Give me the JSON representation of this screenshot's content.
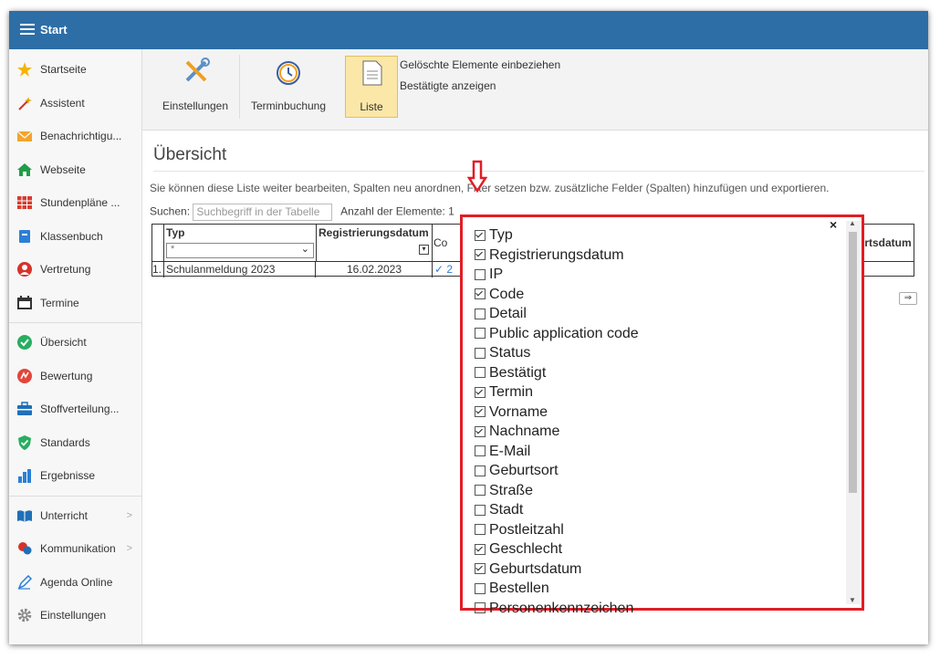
{
  "topbar": {
    "title": "Start"
  },
  "sidebar": {
    "items": [
      {
        "label": "Startseite",
        "icon": "star-icon"
      },
      {
        "label": "Assistent",
        "icon": "magic-wand-icon"
      },
      {
        "label": "Benachrichtigu...",
        "icon": "envelope-icon"
      },
      {
        "label": "Webseite",
        "icon": "home-icon"
      },
      {
        "label": "Stundenpläne ...",
        "icon": "timetable-icon"
      },
      {
        "label": "Klassenbuch",
        "icon": "book-icon"
      },
      {
        "label": "Vertretung",
        "icon": "substitute-icon"
      },
      {
        "label": "Termine",
        "icon": "calendar-icon"
      },
      {
        "label": "Übersicht",
        "icon": "check-circle-icon"
      },
      {
        "label": "Bewertung",
        "icon": "grade-icon"
      },
      {
        "label": "Stoffverteilung...",
        "icon": "briefcase-icon"
      },
      {
        "label": "Standards",
        "icon": "shield-check-icon"
      },
      {
        "label": "Ergebnisse",
        "icon": "bar-chart-icon"
      },
      {
        "label": "Unterricht",
        "icon": "open-book-icon"
      },
      {
        "label": "Kommunikation",
        "icon": "chat-icon"
      },
      {
        "label": "Agenda Online",
        "icon": "pen-icon"
      },
      {
        "label": "Einstellungen",
        "icon": "gear-icon"
      }
    ]
  },
  "ribbon": {
    "settings_label": "Einstellungen",
    "booking_label": "Terminbuchung",
    "list_label": "Liste",
    "opt_deleted": "Gelöschte Elemente einbeziehen",
    "opt_confirmed": "Bestätigte anzeigen"
  },
  "main": {
    "title": "Übersicht",
    "info": "Sie können diese Liste weiter bearbeiten, Spalten neu anordnen, Filter setzen bzw. zusätzliche Felder (Spalten) hinzufügen und exportieren.",
    "search_label": "Suchen:",
    "search_placeholder": "Suchbegriff in der Tabelle",
    "count_label": "Anzahl der Elemente: 1"
  },
  "table": {
    "col_typ": "Typ",
    "col_reg": "Registrierungsdatum",
    "col_code": "Co",
    "col_geb": "urtsdatum",
    "filter_typ": "*",
    "row": {
      "index": "1.",
      "typ": "Schulanmeldung 2023",
      "reg": "16.02.2023",
      "code": "✓ 2"
    }
  },
  "popup": {
    "close": "×",
    "items": [
      {
        "label": "Typ",
        "checked": true
      },
      {
        "label": "Registrierungsdatum",
        "checked": true
      },
      {
        "label": "IP",
        "checked": false
      },
      {
        "label": "Code",
        "checked": true
      },
      {
        "label": "Detail",
        "checked": false
      },
      {
        "label": "Public application code",
        "checked": false
      },
      {
        "label": "Status",
        "checked": false
      },
      {
        "label": "Bestätigt",
        "checked": false
      },
      {
        "label": "Termin",
        "checked": true
      },
      {
        "label": "Vorname",
        "checked": true
      },
      {
        "label": "Nachname",
        "checked": true
      },
      {
        "label": "E-Mail",
        "checked": false
      },
      {
        "label": "Geburtsort",
        "checked": false
      },
      {
        "label": "Straße",
        "checked": false
      },
      {
        "label": "Stadt",
        "checked": false
      },
      {
        "label": "Postleitzahl",
        "checked": false
      },
      {
        "label": "Geschlecht",
        "checked": true
      },
      {
        "label": "Geburtsdatum",
        "checked": true
      },
      {
        "label": "Bestellen",
        "checked": false
      },
      {
        "label": "Personenkennzeichen",
        "checked": false
      }
    ]
  }
}
